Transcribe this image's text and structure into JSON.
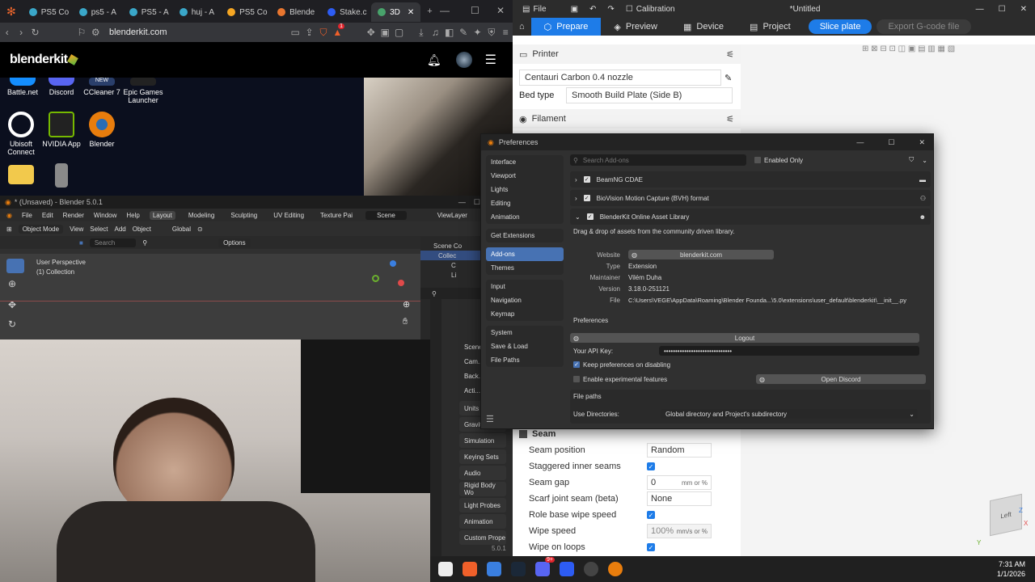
{
  "browser": {
    "tabs": [
      "PS5 Co",
      "ps5 - A",
      "PS5 - A",
      "huj - A",
      "PS5 Co",
      "Blende",
      "Stake.c",
      "3D"
    ],
    "url": "blenderkit.com",
    "site_logo": "blenderkit",
    "notification_badge": "1"
  },
  "desktop": {
    "icons": [
      "Battle.net",
      "Discord",
      "CCleaner 7",
      "Epic Games Launcher",
      "Ubisoft Connect",
      "NVIDIA App",
      "Blender"
    ],
    "ccleaner_badge": "NEW"
  },
  "blender": {
    "title": "* (Unsaved) - Blender 5.0.1",
    "menu": [
      "File",
      "Edit",
      "Render",
      "Window",
      "Help"
    ],
    "workspaces": [
      "Layout",
      "Modeling",
      "Sculpting",
      "UV Editing",
      "Texture Pai"
    ],
    "scene_name": "Scene",
    "view_layer": "ViewLayer",
    "mode": "Object Mode",
    "header_menu": [
      "View",
      "Select",
      "Add",
      "Object"
    ],
    "transform": "Global",
    "search_placeholder": "Search",
    "options": "Options",
    "viewport_label": "User Perspective",
    "viewport_collection": "(1) Collection",
    "outliner": [
      "Scene Co",
      "Collec",
      "C",
      "Li"
    ],
    "props": [
      "Scene",
      "Cam...",
      "Back...",
      "Acti...",
      "Units",
      "Gravity",
      "Simulation",
      "Keying Sets",
      "Audio",
      "Rigid Body Wo",
      "Light Probes",
      "Animation",
      "Custom Prope"
    ],
    "props_header": [
      "S",
      "Sc"
    ],
    "version": "5.0.1"
  },
  "slicer": {
    "title_items": [
      "File",
      "Calibration"
    ],
    "doc_title": "*Untitled",
    "tabs": [
      "Prepare",
      "Preview",
      "Device",
      "Project"
    ],
    "slice_btn": "Slice plate",
    "export_btn": "Export G-code file",
    "printer_section": "Printer",
    "printer": "Centauri Carbon 0.4 nozzle",
    "bed_type_label": "Bed type",
    "bed_type": "Smooth Build Plate (Side B)",
    "filament_section": "Filament",
    "seam_section": "Seam",
    "seam_rows": [
      {
        "label": "Seam position",
        "value": "Random",
        "kind": "combo"
      },
      {
        "label": "Staggered inner seams",
        "value": "",
        "kind": "check"
      },
      {
        "label": "Seam gap",
        "value": "0",
        "unit": "mm or %",
        "kind": "input"
      },
      {
        "label": "Scarf joint seam (beta)",
        "value": "None",
        "kind": "combo"
      },
      {
        "label": "Role base wipe speed",
        "value": "",
        "kind": "check"
      },
      {
        "label": "Wipe speed",
        "value": "100%",
        "unit": "mm/s or %",
        "kind": "input"
      },
      {
        "label": "Wipe on loops",
        "value": "",
        "kind": "check"
      }
    ],
    "cube_label": "Left",
    "axes": [
      "Z",
      "X",
      "Y"
    ]
  },
  "prefs": {
    "title": "Preferences",
    "nav_groups": [
      [
        "Interface",
        "Viewport",
        "Lights",
        "Editing",
        "Animation"
      ],
      [
        "Get Extensions"
      ],
      [
        "Add-ons",
        "Themes"
      ],
      [
        "Input",
        "Navigation",
        "Keymap"
      ],
      [
        "System",
        "Save & Load",
        "File Paths"
      ]
    ],
    "search_placeholder": "Search Add-ons",
    "enabled_only": "Enabled Only",
    "addons": [
      "BeamNG CDAE",
      "BioVision Motion Capture (BVH) format",
      "BlenderKit Online Asset Library"
    ],
    "description": "Drag & drop of assets from the community driven library.",
    "details": {
      "website_label": "Website",
      "website": "blenderkit.com",
      "type_label": "Type",
      "type": "Extension",
      "maintainer_label": "Maintainer",
      "maintainer": "Vilém Duha",
      "version_label": "Version",
      "version": "3.18.0-251121",
      "file_label": "File",
      "file": "C:\\Users\\VEGE\\AppData\\Roaming\\Blender Founda...\\5.0\\extensions\\user_default\\blenderkit\\__init__.py"
    },
    "preferences_label": "Preferences",
    "logout": "Logout",
    "api_key_label": "Your API Key:",
    "api_key": "••••••••••••••••••••••••••••••",
    "keep_prefs": "Keep preferences on disabling",
    "experimental": "Enable experimental features",
    "open_discord": "Open Discord",
    "file_paths": "File paths",
    "use_dirs_label": "Use Directories:",
    "use_dirs": "Global directory and Project's subdirectory"
  },
  "taskbar": {
    "time": "7:31 AM",
    "date": "1/1/2026",
    "badge": "9+"
  },
  "colors": {
    "accent": "#1e7ce8",
    "blender_active": "#4772b3"
  }
}
